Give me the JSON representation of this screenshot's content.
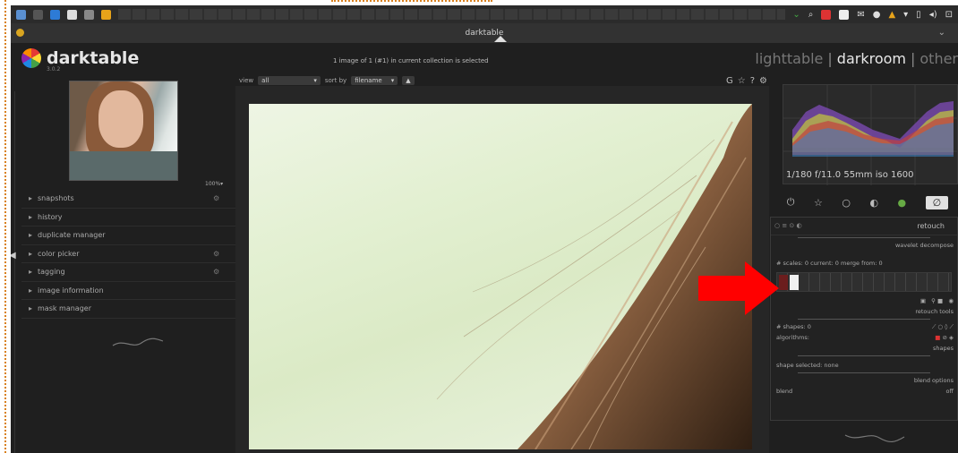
{
  "window": {
    "title": "darktable"
  },
  "app": {
    "name": "darktable",
    "version": "3.0.2"
  },
  "collection": {
    "status": "1 image of 1 (#1) in current collection is selected"
  },
  "views": {
    "lighttable": "lighttable",
    "darkroom": "darkroom",
    "other": "other",
    "separator": "|"
  },
  "filter": {
    "view_label": "view",
    "view_value": "all",
    "sort_label": "sort by",
    "sort_value": "filename"
  },
  "toolbar": {
    "g": "G",
    "star": "☆",
    "help": "?",
    "gear": "⚙"
  },
  "left": {
    "zoom": "100%",
    "modules": [
      {
        "label": "snapshots",
        "opt": "⚙"
      },
      {
        "label": "history",
        "opt": ""
      },
      {
        "label": "duplicate manager",
        "opt": ""
      },
      {
        "label": "color picker",
        "opt": "⚙"
      },
      {
        "label": "tagging",
        "opt": "⚙"
      },
      {
        "label": "image information",
        "opt": ""
      },
      {
        "label": "mask manager",
        "opt": ""
      }
    ]
  },
  "histogram": {
    "info": "1/180 f/11.0 55mm iso 1600"
  },
  "retouch": {
    "title": "retouch",
    "wavelet": "wavelet decompose",
    "scales": "# scales:  0   current:  0   merge from:  0",
    "retouch_tools": "retouch tools",
    "shapes": "# shapes:  0",
    "algorithms": "algorithms:",
    "shapes_label": "shapes",
    "shape_selected": "shape selected:  none",
    "blend_options": "blend options",
    "blend": "blend",
    "off": "off"
  },
  "colors": {
    "accent": "#e8e8e8",
    "arrow": "#ff0000"
  }
}
